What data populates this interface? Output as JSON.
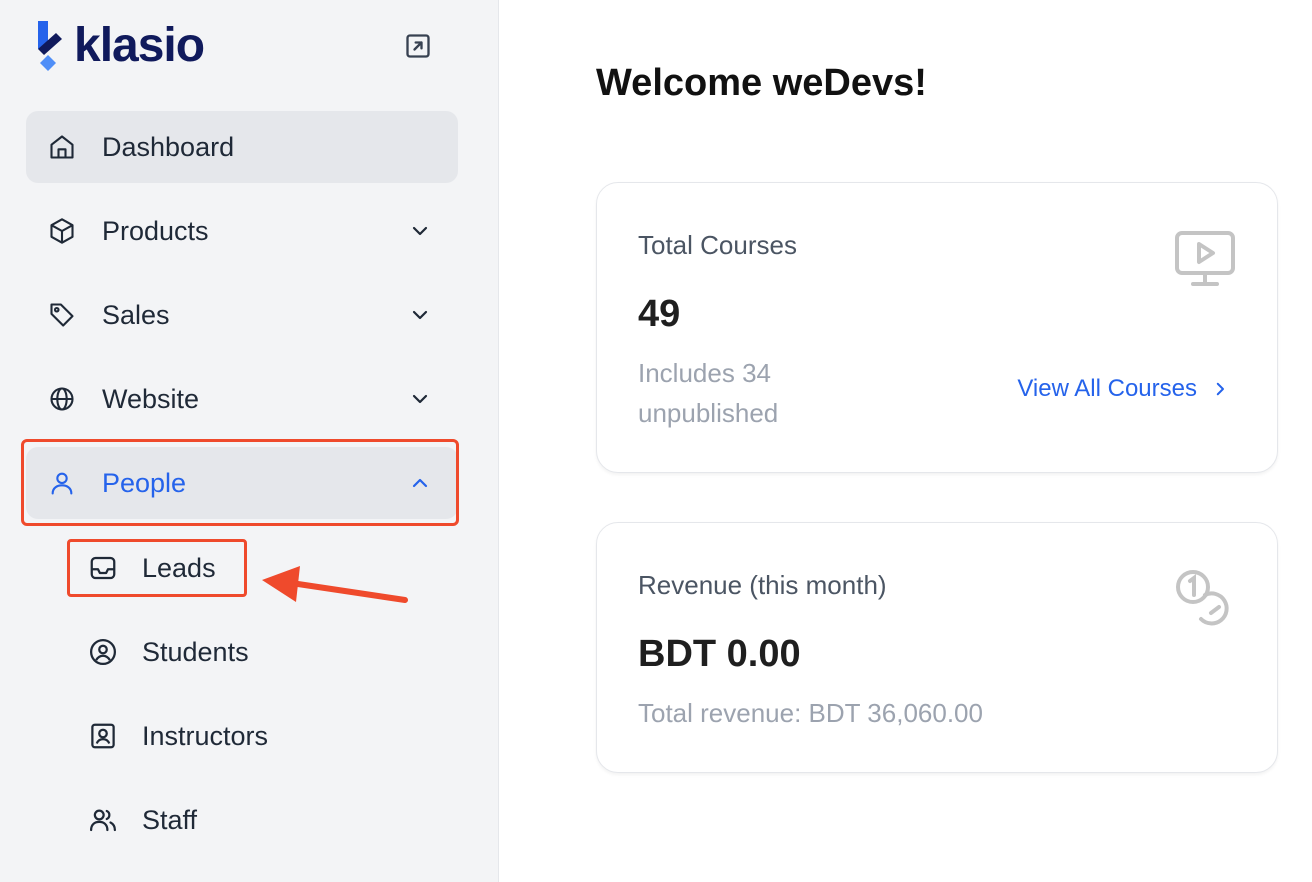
{
  "brand": {
    "name": "klasio"
  },
  "sidebar": {
    "items": [
      {
        "label": "Dashboard",
        "icon": "home-icon"
      },
      {
        "label": "Products",
        "icon": "box-icon"
      },
      {
        "label": "Sales",
        "icon": "tag-icon"
      },
      {
        "label": "Website",
        "icon": "globe-icon"
      },
      {
        "label": "People",
        "icon": "user-icon"
      }
    ],
    "people_subitems": [
      {
        "label": "Leads",
        "icon": "inbox-icon"
      },
      {
        "label": "Students",
        "icon": "user-circle-icon"
      },
      {
        "label": "Instructors",
        "icon": "id-badge-icon"
      },
      {
        "label": "Staff",
        "icon": "users-icon"
      }
    ]
  },
  "main": {
    "welcome": "Welcome weDevs!",
    "courses_card": {
      "title": "Total Courses",
      "value": "49",
      "note_line1": "Includes 34",
      "note_line2": "unpublished",
      "link": "View All Courses",
      "icon": "video-monitor-icon"
    },
    "revenue_card": {
      "title": "Revenue (this month)",
      "value": "BDT 0.00",
      "note": "Total revenue: BDT 36,060.00",
      "icon": "coins-icon"
    }
  },
  "colors": {
    "accent": "#2563eb",
    "highlight": "#ef4a2c",
    "brand_dark": "#101a5c"
  }
}
